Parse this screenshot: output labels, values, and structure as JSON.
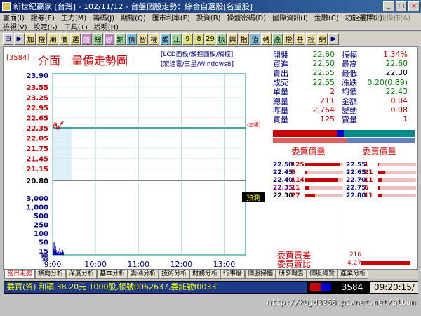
{
  "window": {
    "title": "新世紀贏家 [台灣] - 102/11/12 - 台盤個股走勢：綜合自選股[名望股]",
    "min_label": "_",
    "max_label": "□",
    "restore_label": "▢",
    "close_label": "×"
  },
  "menu_row1": [
    "畫面(I)",
    "證券(E)",
    "主力(M)",
    "籌碼(J)",
    "期權(Q)",
    "匯市利率(E)",
    "投資(B)",
    "操盤密碼(D)",
    "國際資訊(I)",
    "金融(C)",
    "功能選擇(L)"
  ],
  "menu_row1_right": "功能操作(A)",
  "menu_row2": [
    "檢視(V)",
    "設定(S)",
    "工具(T)",
    "說明(H)"
  ],
  "toolbar": {
    "buttons": [
      {
        "label": "⊟",
        "style": "nav"
      },
      {
        "label": "▶",
        "style": "nav"
      },
      {
        "label": "加",
        "style": "c1"
      },
      {
        "label": "權",
        "style": "c1"
      },
      {
        "label": "期",
        "style": "c1"
      },
      {
        "label": "價",
        "style": "c1"
      },
      {
        "label": "選",
        "style": "c1"
      },
      {
        "label": "盤",
        "style": "c3"
      },
      {
        "label": "綜",
        "style": "c2"
      },
      {
        "label": "戀",
        "style": "c3"
      },
      {
        "label": "類",
        "style": "c2"
      },
      {
        "label": "債",
        "style": "c4"
      },
      {
        "label": "智",
        "style": "c1"
      },
      {
        "label": "權",
        "style": "c1"
      },
      {
        "label": "委",
        "style": "c4"
      },
      {
        "label": "江",
        "style": "c2"
      },
      {
        "label": "9",
        "style": "c5"
      },
      {
        "label": "8",
        "style": "c5"
      },
      {
        "label": "29",
        "style": "c5"
      },
      {
        "label": "核",
        "style": "c2"
      },
      {
        "label": "興",
        "style": "c1"
      },
      {
        "label": "指",
        "style": "c1"
      },
      {
        "label": "值",
        "style": "c4"
      },
      {
        "label": "轉",
        "style": "c1"
      },
      {
        "label": "產",
        "style": "c2"
      },
      {
        "label": "權",
        "style": "c1"
      },
      {
        "label": "基",
        "style": "c1"
      },
      {
        "label": "控",
        "style": "c1"
      },
      {
        "label": "網",
        "style": "c1"
      },
      {
        "label": "▶",
        "style": "nav"
      }
    ]
  },
  "chart_header": {
    "code": "[3584]",
    "title": "介面　量價走勢圖",
    "links": [
      "[LCD面板/觸控面板/觸控]",
      "[宏達電/三星/Windows8]"
    ]
  },
  "chart_data": {
    "type": "line",
    "price_ticks": [
      "23.90",
      "23.55",
      "23.25",
      "22.95",
      "22.65",
      "22.35",
      "22.05",
      "21.75",
      "21.45",
      "21.15",
      "20.80"
    ],
    "price_ticks_colors": [
      "#00008b",
      "#c00",
      "#c00",
      "#c00",
      "#c00",
      "#c00",
      "#c00",
      "#c00",
      "#c00",
      "#c00",
      "#000"
    ],
    "volume_ticks": [
      "3,000",
      "1,000",
      "500",
      "250",
      "100",
      "50",
      "15"
    ],
    "volume_unit_label": "張",
    "x_ticks": [
      "9:00",
      "10:00",
      "11:00",
      "12:00",
      "13:00"
    ],
    "ylim": [
      20.8,
      23.9
    ],
    "reference_price": 22.35,
    "reference_label": "(加權)",
    "forecast_button": "預測",
    "price_series": [
      {
        "t": "9:01",
        "price": 22.35
      },
      {
        "t": "9:02",
        "price": 22.45
      },
      {
        "t": "9:03",
        "price": 22.5
      },
      {
        "t": "9:04",
        "price": 22.4
      },
      {
        "t": "9:05",
        "price": 22.5
      },
      {
        "t": "9:06",
        "price": 22.3
      },
      {
        "t": "9:07",
        "price": 22.35
      },
      {
        "t": "9:08",
        "price": 22.4
      },
      {
        "t": "9:09",
        "price": 22.3
      },
      {
        "t": "9:10",
        "price": 22.4
      },
      {
        "t": "9:11",
        "price": 22.45
      },
      {
        "t": "9:12",
        "price": 22.5
      },
      {
        "t": "9:13",
        "price": 22.45
      },
      {
        "t": "9:14",
        "price": 22.5
      },
      {
        "t": "9:15",
        "price": 22.55
      }
    ],
    "volume_series": [
      40,
      90,
      25,
      60,
      35,
      15,
      20,
      30,
      10,
      50,
      20,
      15,
      25,
      35,
      20
    ]
  },
  "quote": {
    "rows": [
      {
        "l1": "開盤",
        "v1": "22.60",
        "c1": "green",
        "l2": "振幅",
        "v2": "1.34%",
        "c2": "red"
      },
      {
        "l1": "買進",
        "v1": "22.50",
        "c1": "green",
        "l2": "最高",
        "v2": "22.60",
        "c2": "green"
      },
      {
        "l1": "賣出",
        "v1": "22.55",
        "c1": "green",
        "l2": "最低",
        "v2": "22.30",
        "c2": "black"
      },
      {
        "l1": "成交",
        "v1": "22.55",
        "c1": "green",
        "l2": "漲跌",
        "v2": "0.20(0.89)",
        "c2": "green"
      },
      {
        "l1": "單量",
        "v1": "2",
        "c1": "red",
        "l2": "均價",
        "v2": "22.43",
        "c2": "green"
      },
      {
        "l1": "總量",
        "v1": "211",
        "c1": "red",
        "l2": "金額",
        "v2": "0.04",
        "c2": "red"
      },
      {
        "l1": "昨量",
        "v1": "2,764",
        "c1": "red",
        "l2": "變動",
        "v2": "0.08",
        "c2": "red"
      },
      {
        "l1": "買量",
        "v1": "125",
        "c1": "red",
        "l2": "賣量",
        "v2": "1",
        "c2": "red"
      }
    ]
  },
  "order_book": {
    "bid_header": "委買價量",
    "ask_header": "委賣價量",
    "bids": [
      {
        "price": "22.50",
        "vol": "125",
        "price_color": "#00008b",
        "fill": 0.9
      },
      {
        "price": "22.45",
        "vol": "5",
        "price_color": "#00008b",
        "fill": 0.05
      },
      {
        "price": "22.40",
        "vol": "114",
        "price_color": "#00008b",
        "fill": 0.85
      },
      {
        "price": "22.35",
        "vol": "11",
        "price_color": "#800080",
        "fill": 0.1
      },
      {
        "price": "22.30",
        "vol": "27",
        "price_color": "#000",
        "fill": 0.25
      }
    ],
    "asks": [
      {
        "price": "22.55",
        "vol": "1",
        "price_color": "#00008b",
        "fill": 0.02
      },
      {
        "price": "22.65",
        "vol": "21",
        "price_color": "#00008b",
        "fill": 0.18
      },
      {
        "price": "22.70",
        "vol": "11",
        "price_color": "#00008b",
        "fill": 0.1
      },
      {
        "price": "22.75",
        "vol": "6",
        "price_color": "#00008b",
        "fill": 0.06
      },
      {
        "price": "22.80",
        "vol": "11",
        "price_color": "#00008b",
        "fill": 0.1
      }
    ]
  },
  "book_summary": {
    "diff_label": "委買賣差",
    "diff_value": "216",
    "ratio_label": "委買賣比",
    "ratio_value": "4.27"
  },
  "tabs": [
    "當日走勢",
    "橫向分析",
    "深度分析",
    "基本分析",
    "籌碼分析",
    "技術分析",
    "財務分析",
    "行事曆",
    "個股掃描",
    "研發報告",
    "個股總覽",
    "產業分析"
  ],
  "status": {
    "ticker": "委買(資) 和碩 38.20元 1000股,帳號0062637,委託號f0033",
    "code": "3584",
    "time": "09:20:15/"
  },
  "watermark": "http://kujd3268.pixnet.net/album",
  "colors": {
    "accent_red": "#cc0000",
    "navy": "#00008b",
    "chart_line": "#008b8b"
  }
}
